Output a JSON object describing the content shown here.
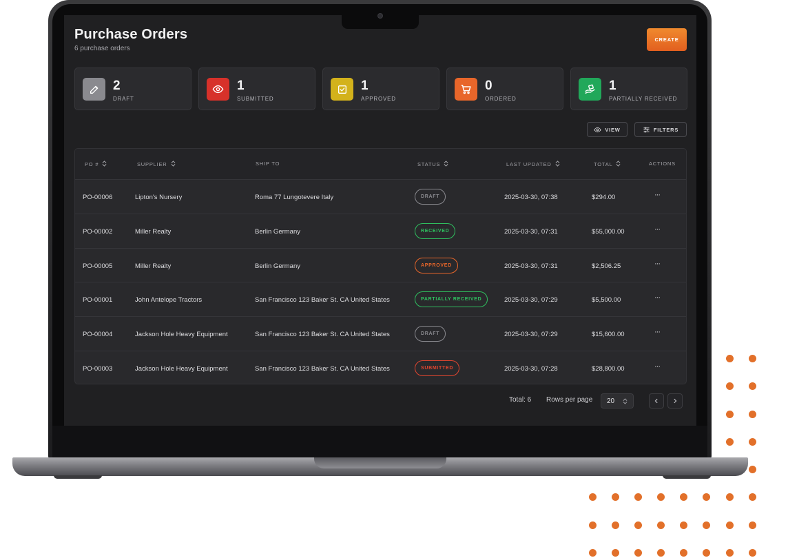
{
  "header": {
    "title": "Purchase Orders",
    "subtitle": "6 purchase orders",
    "create_label": "CREATE"
  },
  "summary_cards": [
    {
      "count": "2",
      "label": "DRAFT",
      "icon": "pencil-icon",
      "color": "#8a8a8f"
    },
    {
      "count": "1",
      "label": "SUBMITTED",
      "icon": "eye-icon",
      "color": "#d7312a"
    },
    {
      "count": "1",
      "label": "APPROVED",
      "icon": "checkbox-icon",
      "color": "#d3b21b"
    },
    {
      "count": "0",
      "label": "ORDERED",
      "icon": "cart-icon",
      "color": "#e8662a"
    },
    {
      "count": "1",
      "label": "PARTIALLY RECEIVED",
      "icon": "hand-box-icon",
      "color": "#21a85a"
    }
  ],
  "toolbar": {
    "view_label": "VIEW",
    "filters_label": "FILTERS"
  },
  "table": {
    "columns": [
      "PO #",
      "SUPPLIER",
      "SHIP TO",
      "STATUS",
      "LAST UPDATED",
      "TOTAL",
      "ACTIONS"
    ],
    "rows": [
      {
        "po": "PO-00006",
        "supplier": "Lipton's Nursery",
        "ship_to": "Roma 77 Lungotevere Italy",
        "status": "DRAFT",
        "updated": "2025-03-30, 07:38",
        "total": "$294.00",
        "actions": "···"
      },
      {
        "po": "PO-00002",
        "supplier": "Miller Realty",
        "ship_to": "Berlin Germany",
        "status": "RECEIVED",
        "updated": "2025-03-30, 07:31",
        "total": "$55,000.00",
        "actions": "···"
      },
      {
        "po": "PO-00005",
        "supplier": "Miller Realty",
        "ship_to": "Berlin Germany",
        "status": "APPROVED",
        "updated": "2025-03-30, 07:31",
        "total": "$2,506.25",
        "actions": "···"
      },
      {
        "po": "PO-00001",
        "supplier": "John Antelope Tractors",
        "ship_to": "San Francisco 123 Baker St. CA United States",
        "status": "PARTIALLY RECEIVED",
        "updated": "2025-03-30, 07:29",
        "total": "$5,500.00",
        "actions": "···"
      },
      {
        "po": "PO-00004",
        "supplier": "Jackson Hole Heavy Equipment",
        "ship_to": "San Francisco 123 Baker St. CA United States",
        "status": "DRAFT",
        "updated": "2025-03-30, 07:29",
        "total": "$15,600.00",
        "actions": "···"
      },
      {
        "po": "PO-00003",
        "supplier": "Jackson Hole Heavy Equipment",
        "ship_to": "San Francisco 123 Baker St. CA United States",
        "status": "SUBMITTED",
        "updated": "2025-03-30, 07:28",
        "total": "$28,800.00",
        "actions": "···"
      }
    ]
  },
  "status_colors": {
    "DRAFT": "#8a8a8f",
    "RECEIVED": "#2fbf5f",
    "APPROVED": "#e8662a",
    "PARTIALLY RECEIVED": "#2fbf5f",
    "SUBMITTED": "#e0452f"
  },
  "pagination": {
    "total_label": "Total: 6",
    "rows_per_page_label": "Rows per page",
    "rows_per_page_value": "20"
  },
  "accent_color": "#e8662a"
}
